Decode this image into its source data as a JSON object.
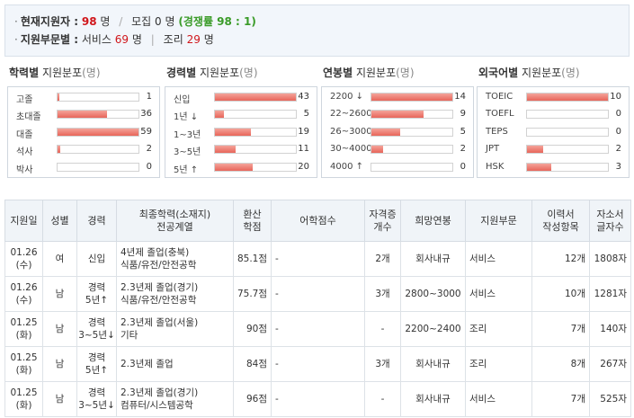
{
  "summary": {
    "applicants_label": "현재지원자 :",
    "applicants_count": "98",
    "unit_people": "명",
    "slash": "/",
    "recruit_label": "모집",
    "recruit_count": "0",
    "competition": "(경쟁률 98 : 1)",
    "dept_label": "지원부문별 :",
    "dept1_name": "서비스",
    "dept1_count": "69",
    "dept_sep": "|",
    "dept2_name": "조리",
    "dept2_count": "29"
  },
  "panels": [
    {
      "title_bold": "학력별",
      "title_rest": "지원분포",
      "unit": "(명)",
      "rows": [
        {
          "label": "고졸",
          "value": "1",
          "ratio": 0.017
        },
        {
          "label": "초대졸",
          "value": "36",
          "ratio": 0.61
        },
        {
          "label": "대졸",
          "value": "59",
          "ratio": 1.0
        },
        {
          "label": "석사",
          "value": "2",
          "ratio": 0.034
        },
        {
          "label": "박사",
          "value": "0",
          "ratio": 0.0
        }
      ]
    },
    {
      "title_bold": "경력별",
      "title_rest": "지원분포",
      "unit": "(명)",
      "rows": [
        {
          "label": "신입",
          "value": "43",
          "ratio": 1.0
        },
        {
          "label": "1년 ↓",
          "value": "5",
          "ratio": 0.116
        },
        {
          "label": "1~3년",
          "value": "19",
          "ratio": 0.442
        },
        {
          "label": "3~5년",
          "value": "11",
          "ratio": 0.256
        },
        {
          "label": "5년 ↑",
          "value": "20",
          "ratio": 0.465
        }
      ]
    },
    {
      "title_bold": "연봉별",
      "title_rest": "지원분포",
      "unit": "(명)",
      "rows": [
        {
          "label": "2200 ↓",
          "value": "14",
          "ratio": 1.0
        },
        {
          "label": "22~2600",
          "value": "9",
          "ratio": 0.643
        },
        {
          "label": "26~3000",
          "value": "5",
          "ratio": 0.357
        },
        {
          "label": "30~4000",
          "value": "2",
          "ratio": 0.143
        },
        {
          "label": "4000 ↑",
          "value": "0",
          "ratio": 0.0
        }
      ]
    },
    {
      "title_bold": "외국어별",
      "title_rest": "지원분포",
      "unit": "(명)",
      "rows": [
        {
          "label": "TOEIC",
          "value": "10",
          "ratio": 1.0
        },
        {
          "label": "TOEFL",
          "value": "0",
          "ratio": 0.0
        },
        {
          "label": "TEPS",
          "value": "0",
          "ratio": 0.0
        },
        {
          "label": "JPT",
          "value": "2",
          "ratio": 0.2
        },
        {
          "label": "HSK",
          "value": "3",
          "ratio": 0.3
        }
      ]
    }
  ],
  "table": {
    "headers": {
      "date": "지원일",
      "gender": "성별",
      "career": "경력",
      "edu1": "최종학력(소재지)",
      "edu2": "전공계열",
      "score1": "환산",
      "score2": "학점",
      "lang": "어학점수",
      "cert1": "자격증",
      "cert2": "개수",
      "salary": "희망연봉",
      "dept": "지원부문",
      "resume1": "이력서",
      "resume2": "작성항목",
      "intro1": "자소서",
      "intro2": "글자수"
    },
    "rows": [
      {
        "date1": "01.26",
        "date2": "(수)",
        "gender": "여",
        "career1": "신입",
        "career2": "",
        "edu1": "4년제 졸업(충북)",
        "edu2": "식품/유전/안전공학",
        "score": "85.1점",
        "lang": "-",
        "cert": "2개",
        "salary": "회사내규",
        "dept": "서비스",
        "resume": "12개",
        "intro": "1808자"
      },
      {
        "date1": "01.26",
        "date2": "(수)",
        "gender": "남",
        "career1": "경력",
        "career2": "5년↑",
        "edu1": "2.3년제 졸업(경기)",
        "edu2": "식품/유전/안전공학",
        "score": "75.7점",
        "lang": "-",
        "cert": "3개",
        "salary": "2800~3000",
        "dept": "서비스",
        "resume": "10개",
        "intro": "1281자"
      },
      {
        "date1": "01.25",
        "date2": "(화)",
        "gender": "남",
        "career1": "경력",
        "career2": "3~5년↓",
        "edu1": "2.3년제 졸업(서울)",
        "edu2": "기타",
        "score": "90점",
        "lang": "-",
        "cert": "-",
        "salary": "2200~2400",
        "dept": "조리",
        "resume": "7개",
        "intro": "140자"
      },
      {
        "date1": "01.25",
        "date2": "(화)",
        "gender": "남",
        "career1": "경력",
        "career2": "5년↑",
        "edu1": "2.3년제 졸업",
        "edu2": "",
        "score": "84점",
        "lang": "-",
        "cert": "3개",
        "salary": "회사내규",
        "dept": "조리",
        "resume": "8개",
        "intro": "267자"
      },
      {
        "date1": "01.25",
        "date2": "(화)",
        "gender": "남",
        "career1": "경력",
        "career2": "3~5년↓",
        "edu1": "2.3년제 졸업(경기)",
        "edu2": "컴퓨터/시스템공학",
        "score": "96점",
        "lang": "-",
        "cert": "-",
        "salary": "회사내규",
        "dept": "서비스",
        "resume": "7개",
        "intro": "525자"
      }
    ]
  }
}
